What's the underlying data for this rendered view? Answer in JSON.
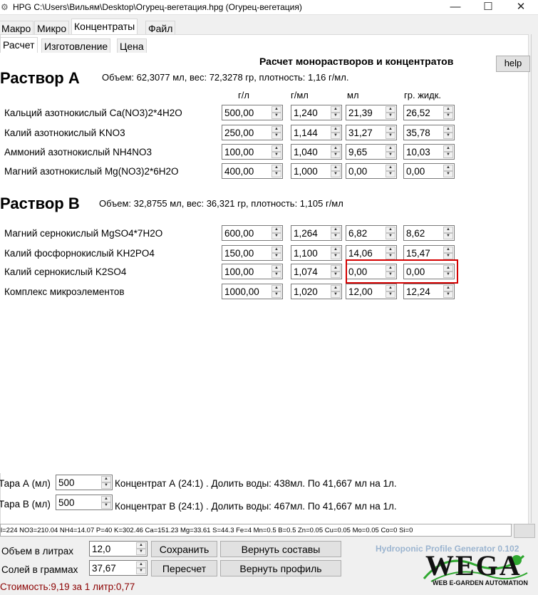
{
  "window": {
    "title": "HPG C:\\Users\\Вильям\\Desktop\\Огурец-вегетация.hpg (Огурец-вегетация)",
    "minimize": "—",
    "maximize": "☐",
    "close": "✕"
  },
  "main_tabs": [
    "Макро",
    "Микро",
    "Концентраты",
    "Файл"
  ],
  "sub_tabs": [
    "Расчет",
    "Изготовление",
    "Цена"
  ],
  "page_title": "Расчет монорастворов и концентратов",
  "help_label": "help",
  "solution_a": {
    "heading": "Раствор А",
    "info": "Объем: 62,3077 мл, вес: 72,3278 гр, плотность: 1,16 г/мл."
  },
  "columns": [
    "г/л",
    "г/мл",
    "мл",
    "гр. жидк."
  ],
  "rows_a": [
    {
      "label": "Кальций азотнокислый Ca(NO3)2*4H2O",
      "v": [
        "500,00",
        "1,240",
        "21,39",
        "26,52"
      ]
    },
    {
      "label": "Калий азотнокислый KNO3",
      "v": [
        "250,00",
        "1,144",
        "31,27",
        "35,78"
      ]
    },
    {
      "label": "Аммоний азотнокислый NH4NO3",
      "v": [
        "100,00",
        "1,040",
        "9,65",
        "10,03"
      ]
    },
    {
      "label": "Магний азотнокислый Mg(NO3)2*6H2O",
      "v": [
        "400,00",
        "1,000",
        "0,00",
        "0,00"
      ]
    }
  ],
  "solution_b": {
    "heading": "Раствор В",
    "info": "Объем: 32,8755 мл, вес: 36,321 гр, плотность: 1,105 г/мл"
  },
  "rows_b": [
    {
      "label": "Магний сернокислый MgSO4*7H2O",
      "v": [
        "600,00",
        "1,264",
        "6,82",
        "8,62"
      ]
    },
    {
      "label": "Калий фосфорнокислый KH2PO4",
      "v": [
        "150,00",
        "1,100",
        "14,06",
        "15,47"
      ]
    },
    {
      "label": "Калий сернокислый K2SO4",
      "v": [
        "100,00",
        "1,074",
        "0,00",
        "0,00"
      ]
    },
    {
      "label": "Комплекс микроэлементов",
      "v": [
        "1000,00",
        "1,020",
        "12,00",
        "12,24"
      ]
    }
  ],
  "tara": [
    {
      "label": "Тара А (мл)",
      "value": "500",
      "text": "Концентрат А (24:1) . Долить воды: 438мл. По 41,667 мл на 1л."
    },
    {
      "label": "Тара В (мл)",
      "value": "500",
      "text": "Концентрат В (24:1) . Долить воды: 467мл. По 41,667 мл на 1л."
    }
  ],
  "status_line": "l=224 NO3=210.04 NH4=14.07 P=40 K=302.46 Ca=151.23 Mg=33.61 S=44.3 Fe=4 Mn=0.5 B=0.5 Zn=0.05 Cu=0.05 Mo=0.05 Co=0 Si=0",
  "volume": {
    "label": "Объем в литрах",
    "value": "12,0"
  },
  "salts": {
    "label": "Солей в граммах",
    "value": "37,67"
  },
  "buttons": {
    "save": "Сохранить",
    "restore_compositions": "Вернуть составы",
    "recalc": "Пересчет",
    "restore_profile": "Вернуть профиль"
  },
  "cost": "Стоимость:9,19 за 1 литр:0,77",
  "branding": {
    "generator": "Hydroponic Profile Generator 0.102",
    "logo": "WEGA",
    "logo_sub": "WEB E-GARDEN AUTOMATION"
  },
  "colors": {
    "highlight": "#d40000",
    "cost_text": "#8b0000",
    "logo_green": "#2fa830",
    "generator_text": "#9cb5d0"
  }
}
